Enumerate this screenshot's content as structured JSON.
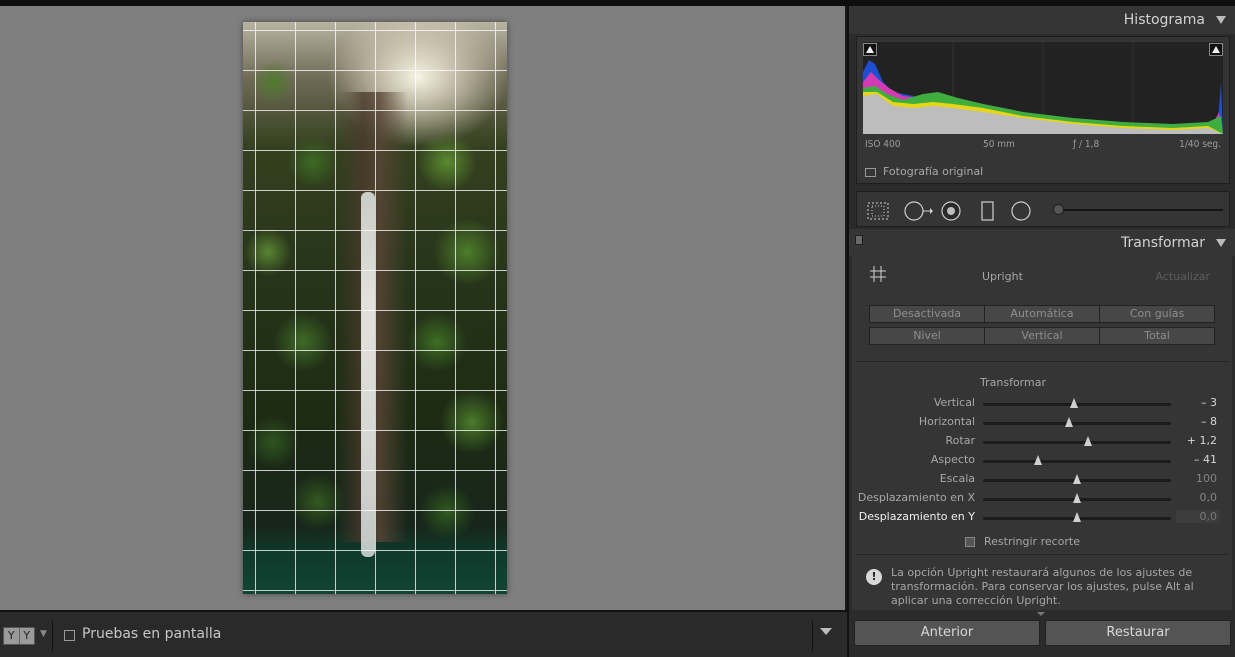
{
  "toolbar": {
    "view_mode_left": "Y",
    "view_mode_right": "Y",
    "soft_proof_label": "Pruebas en pantalla"
  },
  "histogram": {
    "title": "Histograma",
    "iso": "ISO 400",
    "focal": "50 mm",
    "aperture": "ƒ / 1,8",
    "shutter": "1/40 seg.",
    "original_photo_label": "Fotografía original"
  },
  "transform": {
    "title": "Transformar",
    "upright_label": "Upright",
    "update_label": "Actualizar",
    "upright_modes_row1": [
      "Desactivada",
      "Automática",
      "Con guías"
    ],
    "upright_modes_row2": [
      "Nivel",
      "Vertical",
      "Total"
    ],
    "sliders_title": "Transformar",
    "sliders": [
      {
        "label": "Vertical",
        "value": "– 3",
        "level": -3,
        "min": -100,
        "max": 100
      },
      {
        "label": "Horizontal",
        "value": "– 8",
        "level": -8,
        "min": -100,
        "max": 100
      },
      {
        "label": "Rotar",
        "value": "+ 1,2",
        "level": 1.2,
        "min": -10,
        "max": 10
      },
      {
        "label": "Aspecto",
        "value": "– 41",
        "level": -41,
        "min": -100,
        "max": 100
      },
      {
        "label": "Escala",
        "value": "100",
        "level": 100,
        "min": 50,
        "max": 150
      },
      {
        "label": "Desplazamiento en X",
        "value": "0,0",
        "level": 0,
        "min": -100,
        "max": 100
      },
      {
        "label": "Desplazamiento en Y",
        "value": "0,0",
        "level": 0,
        "min": -100,
        "max": 100
      }
    ],
    "constrain_crop_label": "Restringir recorte",
    "warning_text": "La opción Upright restaurará algunos de los ajustes de transformación. Para conservar los ajustes, pulse Alt al aplicar una corrección Upright."
  },
  "buttons": {
    "previous": "Anterior",
    "reset": "Restaurar"
  },
  "colors": {
    "canvas_bg": "#7f7f7f",
    "panel_bg": "#353535",
    "app_bg": "#2b2b2b"
  }
}
